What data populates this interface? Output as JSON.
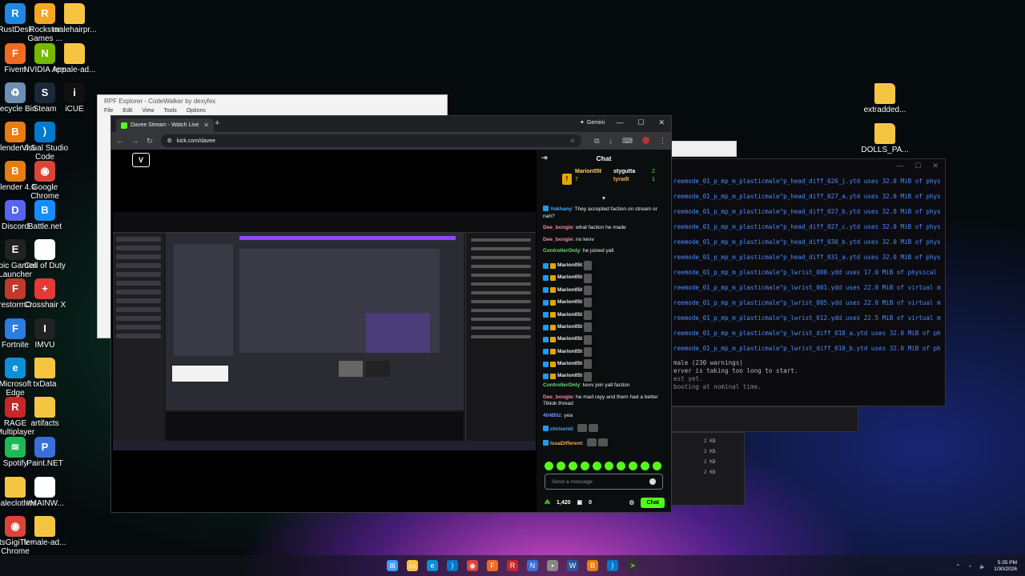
{
  "desktop": {
    "left_icons": [
      {
        "label": "RustDesk",
        "color": "#1e88e5",
        "glyph": "R"
      },
      {
        "label": "Rockstar Games ...",
        "color": "#f5a623",
        "glyph": "R"
      },
      {
        "label": "malehairpr...",
        "color": "#f5c542",
        "glyph": ""
      },
      {
        "label": "Fivem",
        "color": "#f26b21",
        "glyph": "F"
      },
      {
        "label": "NVIDIA App",
        "color": "#76b900",
        "glyph": "N"
      },
      {
        "label": "female-ad...",
        "color": "#f5c542",
        "glyph": ""
      },
      {
        "label": "Recycle Bin",
        "color": "#6c8fb3",
        "glyph": "♻"
      },
      {
        "label": "Steam",
        "color": "#1b2838",
        "glyph": "S"
      },
      {
        "label": "iCUE",
        "color": "#111111",
        "glyph": "i"
      },
      {
        "label": "Blender 3.5",
        "color": "#e87d0d",
        "glyph": "B"
      },
      {
        "label": "Visual Studio Code",
        "color": "#007acc",
        "glyph": "⟩"
      },
      {
        "label": "Blender 4.0",
        "color": "#e87d0d",
        "glyph": "B"
      },
      {
        "label": "Google Chrome",
        "color": "#db4437",
        "glyph": "◉"
      },
      {
        "label": "Discord",
        "color": "#5865f2",
        "glyph": "D"
      },
      {
        "label": "Battle.net",
        "color": "#148eff",
        "glyph": "B"
      },
      {
        "label": "Epic Games Launcher",
        "color": "#222222",
        "glyph": "E"
      },
      {
        "label": "Call of Duty",
        "color": "#ffffff",
        "glyph": ""
      },
      {
        "label": "FirestormO...",
        "color": "#c0392b",
        "glyph": "F"
      },
      {
        "label": "Crosshair X",
        "color": "#e53935",
        "glyph": "+"
      },
      {
        "label": "Fortnite",
        "color": "#2a7de1",
        "glyph": "F"
      },
      {
        "label": "IMVU",
        "color": "#222222",
        "glyph": "I"
      },
      {
        "label": "Microsoft Edge",
        "color": "#0c8fd6",
        "glyph": "e"
      },
      {
        "label": "txData",
        "color": "#f5c542",
        "glyph": ""
      },
      {
        "label": "RAGE Multiplayer",
        "color": "#c62828",
        "glyph": "R"
      },
      {
        "label": "artifacts",
        "color": "#f5c542",
        "glyph": ""
      },
      {
        "label": "Spotify",
        "color": "#1db954",
        "glyph": "≋"
      },
      {
        "label": "Paint.NET",
        "color": "#3a6fd8",
        "glyph": "P"
      },
      {
        "label": "maleclothes",
        "color": "#f5c542",
        "glyph": ""
      },
      {
        "label": "#MAINW...",
        "color": "#ffffff",
        "glyph": ""
      },
      {
        "label": "ItsGigiTv - Chrome",
        "color": "#db4437",
        "glyph": "◉"
      },
      {
        "label": "female-ad...",
        "color": "#f5c542",
        "glyph": ""
      }
    ],
    "right_icons": [
      {
        "label": "extradded...",
        "color": "#f5c542",
        "glyph": ""
      },
      {
        "label": "DOLLS_PA...",
        "color": "#f5c542",
        "glyph": ""
      }
    ]
  },
  "rpf_window": {
    "title": "RPF Explorer - CodeWalker by dexyfex",
    "menu": [
      "File",
      "Edit",
      "View",
      "Tools",
      "Options"
    ]
  },
  "terminal": {
    "lines": [
      "reemode_01_p_mp_m_plasticmale^p_head_diff_026_j.ytd uses 32.0 MiB of phys",
      "reemode_01_p_mp_m_plasticmale^p_head_diff_027_a.ytd uses 32.0 MiB of phys",
      "reemode_01_p_mp_m_plasticmale^p_head_diff_027_b.ytd uses 32.0 MiB of phys",
      "reemode_01_p_mp_m_plasticmale^p_head_diff_027_c.ytd uses 32.0 MiB of phys",
      "reemode_01_p_mp_m_plasticmale^p_head_diff_030_b.ytd uses 32.0 MiB of phys",
      "reemode_01_p_mp_m_plasticmale^p_head_diff_031_a.ytd uses 32.0 MiB of phys",
      "reemode_01_p_mp_m_plasticmale^p_lwrist_000.ydd uses 17.0 MiB of physical",
      "reemode_01_p_mp_m_plasticmale^p_lwrist_001.ydd uses 22.0 MiB of virtual m",
      "reemode_01_p_mp_m_plasticmale^p_lwrist_005.ydd uses 22.0 MiB of virtual m",
      "reemode_01_p_mp_m_plasticmale^p_lwrist_012.ydd uses 22.5 MiB of virtual m",
      "reemode_01_p_mp_m_plasticmale^p_lwrist_diff_010_a.ytd uses 32.0 MiB of ph",
      "reemode_01_p_mp_m_plasticmale^p_lwrist_diff_010_b.ytd uses 32.0 MiB of ph"
    ],
    "status_lines": [
      "male (230 warnings)",
      "erver is taking too long to start."
    ],
    "dim_lines": [
      "est yet.",
      "booting at nominal time."
    ],
    "lower_sizes": [
      "2 KB",
      "2 KB",
      "2 KB",
      "2 KB"
    ]
  },
  "browser": {
    "tab_title": "Davee Stream - Watch Live",
    "new_tab": "+",
    "gemini_label": "Gemini",
    "url": "kick.com/davee",
    "close": "✕",
    "minimize": "—",
    "maximize": "☐"
  },
  "video": {
    "logo": "V"
  },
  "chat": {
    "title": "Chat",
    "leaders": {
      "first_name": "Marion05t",
      "first_count": "7",
      "second_name": "stygutta",
      "second_count": "2",
      "third_name": "tyradt",
      "third_count": "1"
    },
    "messages_top": [
      {
        "user": "Yokhany",
        "user_color": "#4dabf7",
        "text": "They accepted faction on stream or nah?",
        "badge": true
      },
      {
        "user": "Dee_boogie",
        "user_color": "#f783ac",
        "text": "what faction he made",
        "badge": false
      },
      {
        "user": "Dee_boogie",
        "user_color": "#f783ac",
        "text": "no kevv",
        "badge": false
      },
      {
        "user": "ControllerOnly",
        "user_color": "#69db7c",
        "text": "he joined yall",
        "badge": false
      }
    ],
    "spam_user": "Marion05t",
    "spam_count": 10,
    "messages_bottom": [
      {
        "user": "ControllerOnly",
        "user_color": "#69db7c",
        "text": "kevv join yall faction",
        "badge": false
      },
      {
        "user": "Dee_boogie",
        "user_color": "#f783ac",
        "text": "he mad rayy and them had a better Tiktok thread",
        "badge": false
      },
      {
        "user": "404Bllz",
        "user_color": "#748ffc",
        "text": "yea",
        "badge": false
      },
      {
        "user": "chrisvrid",
        "user_color": "#4dabf7",
        "text": "",
        "badge": true
      },
      {
        "user": "IssaDifferent",
        "user_color": "#ffa94d",
        "text": "",
        "badge": true
      }
    ],
    "input_placeholder": "Send a message",
    "points": "1,420",
    "gifts": "0",
    "chat_button": "Chat"
  },
  "taskbar": {
    "apps": [
      {
        "name": "start",
        "color": "#3b9cff",
        "glyph": "⊞"
      },
      {
        "name": "file-explorer",
        "color": "#f5c542",
        "glyph": "▭"
      },
      {
        "name": "edge",
        "color": "#0c8fd6",
        "glyph": "e"
      },
      {
        "name": "vscode",
        "color": "#007acc",
        "glyph": "⟩"
      },
      {
        "name": "chrome",
        "color": "#db4437",
        "glyph": "◉"
      },
      {
        "name": "fivem",
        "color": "#f26b21",
        "glyph": "F"
      },
      {
        "name": "rage",
        "color": "#c62828",
        "glyph": "R"
      },
      {
        "name": "notepad",
        "color": "#3a6fd8",
        "glyph": "N"
      },
      {
        "name": "app-1",
        "color": "#888888",
        "glyph": "▪"
      },
      {
        "name": "word",
        "color": "#2b579a",
        "glyph": "W"
      },
      {
        "name": "blender",
        "color": "#e87d0d",
        "glyph": "B"
      },
      {
        "name": "vs",
        "color": "#007acc",
        "glyph": "⟩"
      },
      {
        "name": "terminal",
        "color": "#333333",
        "glyph": ">"
      }
    ],
    "time": "5:35 PM",
    "date": "1/30/2026"
  }
}
